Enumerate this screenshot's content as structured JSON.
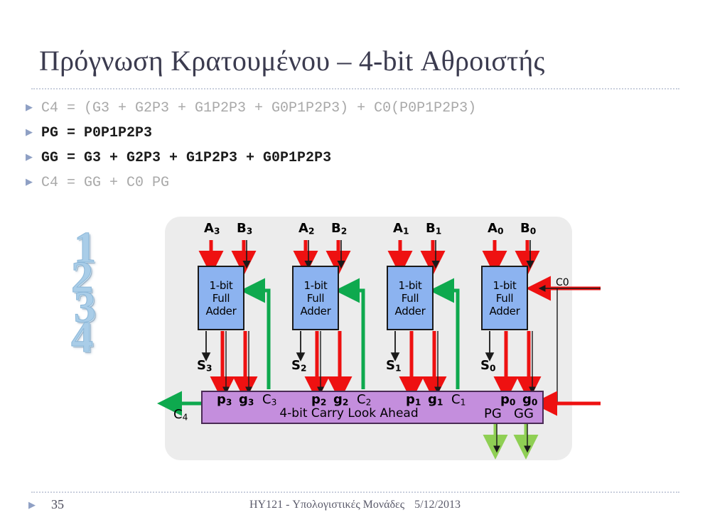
{
  "slide": {
    "title": "Πρόγνωση Κρατουμένου – 4-bit Αθροιστής",
    "bullets": [
      {
        "text": "C4 = (G3 + G2P3 + G1P2P3 + G0P1P2P3) + C0(P0P1P2P3)",
        "emphasis": false
      },
      {
        "text": "PG = P0P1P2P3",
        "emphasis": true
      },
      {
        "text": "GG = G3 + G2P3 + G1P2P3 + G0P1P2P3",
        "emphasis": true
      },
      {
        "text": "C4 = GG + C0 PG",
        "emphasis": false
      }
    ],
    "bullet_marker": "▶"
  },
  "watermark": {
    "digits": [
      "1",
      "2",
      "3",
      "4"
    ]
  },
  "diagram": {
    "colors": {
      "panel_bg": "#ececec",
      "adder_fill": "#8cb3f0",
      "adder_stroke": "#1a1a1a",
      "cla_fill": "#c48edd",
      "cla_stroke": "#4a2b55",
      "signal_red": "#ee1111",
      "carry_green": "#0ea94e",
      "out_green": "#8fcf54",
      "wire_black": "#1a1a1a"
    },
    "adders": [
      {
        "id": "adder-3",
        "lines": [
          "1-bit",
          "Full",
          "Adder"
        ]
      },
      {
        "id": "adder-2",
        "lines": [
          "1-bit",
          "Full",
          "Adder"
        ]
      },
      {
        "id": "adder-1",
        "lines": [
          "1-bit",
          "Full",
          "Adder"
        ]
      },
      {
        "id": "adder-0",
        "lines": [
          "1-bit",
          "Full",
          "Adder"
        ]
      }
    ],
    "cla": {
      "label": "4-bit Carry Look Ahead"
    },
    "inputs": [
      {
        "a": "A",
        "a_sub": "3",
        "b": "B",
        "b_sub": "3"
      },
      {
        "a": "A",
        "a_sub": "2",
        "b": "B",
        "b_sub": "2"
      },
      {
        "a": "A",
        "a_sub": "1",
        "b": "B",
        "b_sub": "1"
      },
      {
        "a": "A",
        "a_sub": "0",
        "b": "B",
        "b_sub": "0"
      }
    ],
    "sums": [
      {
        "name": "S",
        "sub": "3"
      },
      {
        "name": "S",
        "sub": "2"
      },
      {
        "name": "S",
        "sub": "1"
      },
      {
        "name": "S",
        "sub": "0"
      }
    ],
    "pg_pairs": [
      {
        "p": "p",
        "p_sub": "3",
        "g": "g",
        "g_sub": "3"
      },
      {
        "p": "p",
        "p_sub": "2",
        "g": "g",
        "g_sub": "2"
      },
      {
        "p": "p",
        "p_sub": "1",
        "g": "g",
        "g_sub": "1"
      },
      {
        "p": "p",
        "p_sub": "0",
        "g": "g",
        "g_sub": "0"
      }
    ],
    "carries": [
      {
        "name": "C",
        "sub": "3"
      },
      {
        "name": "C",
        "sub": "2"
      },
      {
        "name": "C",
        "sub": "1"
      }
    ],
    "carry_out": {
      "name": "C",
      "sub": "4"
    },
    "carry_in": {
      "name": "C0"
    },
    "group_outputs": [
      {
        "name": "PG"
      },
      {
        "name": "GG"
      }
    ]
  },
  "footer": {
    "page_number": "35",
    "course": "HY121 - Υπολογιστικές Μονάδες",
    "date": "5/12/2013",
    "marker": "▶"
  }
}
